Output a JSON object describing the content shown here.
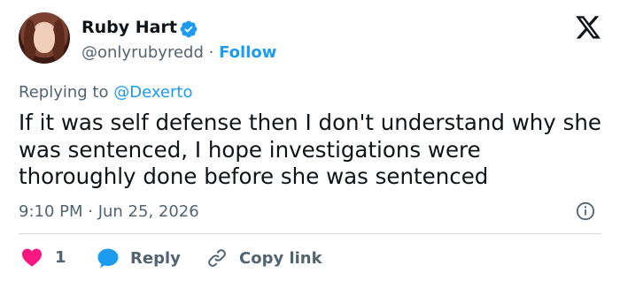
{
  "author": {
    "name": "Ruby Hart",
    "handle": "@onlyrubyredd",
    "separator": "·",
    "follow_label": "Follow",
    "verified": true
  },
  "reply_context": {
    "prefix": "Replying to",
    "mention": "@Dexerto"
  },
  "tweet": {
    "text": "If it was self defense then I don't understand why she was sentenced, I hope investigations were thoroughly done before she was sentenced",
    "timestamp": "9:10 PM · Jun 25, 2026"
  },
  "actions": {
    "like_count": "1",
    "reply_label": "Reply",
    "copy_link_label": "Copy link"
  },
  "colors": {
    "accent": "#1d9bf0",
    "like": "#f91880",
    "muted": "#536471",
    "text": "#0f1419"
  },
  "icons": [
    "verified-badge-icon",
    "x-logo-icon",
    "info-icon",
    "heart-icon",
    "reply-bubble-icon",
    "link-icon"
  ]
}
